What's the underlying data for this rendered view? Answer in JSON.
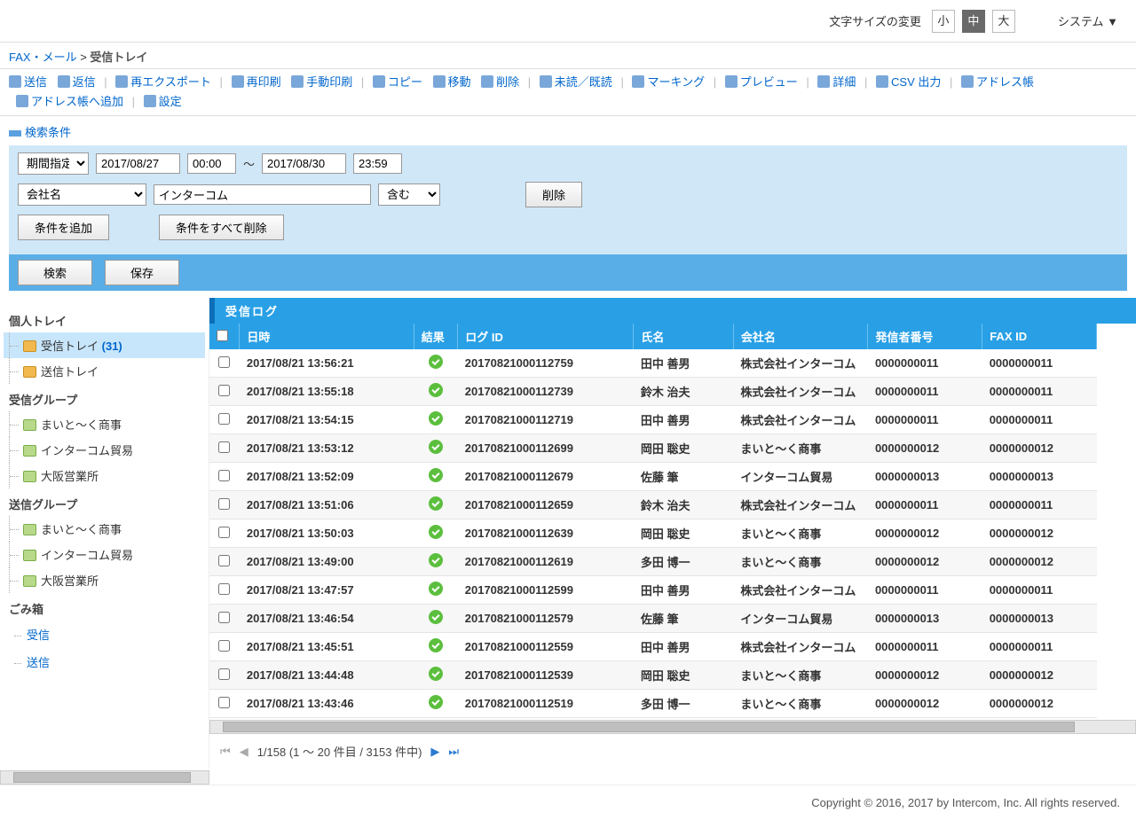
{
  "topbar": {
    "font_size_label": "文字サイズの変更",
    "small": "小",
    "medium": "中",
    "large": "大",
    "system": "システム ▼"
  },
  "breadcrumb": {
    "root": "FAX・メール",
    "sep": " > ",
    "current": "受信トレイ"
  },
  "toolbar": {
    "send": "送信",
    "reply": "返信",
    "reexport": "再エクスポート",
    "reprint": "再印刷",
    "manual_print": "手動印刷",
    "copy": "コピー",
    "move": "移動",
    "delete": "削除",
    "read_unread": "未読／既読",
    "marking": "マーキング",
    "preview": "プレビュー",
    "detail": "詳細",
    "csv": "CSV 出力",
    "addrbook": "アドレス帳",
    "addrbook_add": "アドレス帳へ追加",
    "settings": "設定"
  },
  "search": {
    "title": "検索条件",
    "period_select": "期間指定",
    "date_from": "2017/08/27",
    "time_from": "00:00",
    "tilde": "〜",
    "date_to": "2017/08/30",
    "time_to": "23:59",
    "field_select": "会社名",
    "value": "インターコム",
    "match_select": "含む",
    "row_delete": "削除",
    "add_condition": "条件を追加",
    "clear_all": "条件をすべて削除",
    "search_btn": "検索",
    "save_btn": "保存"
  },
  "sidebar": {
    "personal": "個人トレイ",
    "inbox": "受信トレイ",
    "inbox_count": "(31)",
    "outbox": "送信トレイ",
    "recv_group": "受信グループ",
    "send_group": "送信グループ",
    "groups": [
      "まいと〜く商事",
      "インターコム貿易",
      "大阪営業所"
    ],
    "trash": "ごみ箱",
    "trash_recv": "受信",
    "trash_send": "送信"
  },
  "content": {
    "title": "受信ログ",
    "headers": {
      "datetime": "日時",
      "result": "結果",
      "logid": "ログ ID",
      "name": "氏名",
      "company": "会社名",
      "caller": "発信者番号",
      "faxid": "FAX ID"
    },
    "rows": [
      {
        "dt": "2017/08/21 13:56:21",
        "id": "20170821000112759",
        "name": "田中 善男",
        "co": "株式会社インターコム",
        "num": "0000000011",
        "fax": "0000000011"
      },
      {
        "dt": "2017/08/21 13:55:18",
        "id": "20170821000112739",
        "name": "鈴木 治夫",
        "co": "株式会社インターコム",
        "num": "0000000011",
        "fax": "0000000011"
      },
      {
        "dt": "2017/08/21 13:54:15",
        "id": "20170821000112719",
        "name": "田中 善男",
        "co": "株式会社インターコム",
        "num": "0000000011",
        "fax": "0000000011"
      },
      {
        "dt": "2017/08/21 13:53:12",
        "id": "20170821000112699",
        "name": "岡田 聡史",
        "co": "まいと〜く商事",
        "num": "0000000012",
        "fax": "0000000012"
      },
      {
        "dt": "2017/08/21 13:52:09",
        "id": "20170821000112679",
        "name": "佐藤 筆",
        "co": "インターコム貿易",
        "num": "0000000013",
        "fax": "0000000013"
      },
      {
        "dt": "2017/08/21 13:51:06",
        "id": "20170821000112659",
        "name": "鈴木 治夫",
        "co": "株式会社インターコム",
        "num": "0000000011",
        "fax": "0000000011"
      },
      {
        "dt": "2017/08/21 13:50:03",
        "id": "20170821000112639",
        "name": "岡田 聡史",
        "co": "まいと〜く商事",
        "num": "0000000012",
        "fax": "0000000012"
      },
      {
        "dt": "2017/08/21 13:49:00",
        "id": "20170821000112619",
        "name": "多田 博一",
        "co": "まいと〜く商事",
        "num": "0000000012",
        "fax": "0000000012"
      },
      {
        "dt": "2017/08/21 13:47:57",
        "id": "20170821000112599",
        "name": "田中 善男",
        "co": "株式会社インターコム",
        "num": "0000000011",
        "fax": "0000000011"
      },
      {
        "dt": "2017/08/21 13:46:54",
        "id": "20170821000112579",
        "name": "佐藤 筆",
        "co": "インターコム貿易",
        "num": "0000000013",
        "fax": "0000000013"
      },
      {
        "dt": "2017/08/21 13:45:51",
        "id": "20170821000112559",
        "name": "田中 善男",
        "co": "株式会社インターコム",
        "num": "0000000011",
        "fax": "0000000011"
      },
      {
        "dt": "2017/08/21 13:44:48",
        "id": "20170821000112539",
        "name": "岡田 聡史",
        "co": "まいと〜く商事",
        "num": "0000000012",
        "fax": "0000000012"
      },
      {
        "dt": "2017/08/21 13:43:46",
        "id": "20170821000112519",
        "name": "多田 博一",
        "co": "まいと〜く商事",
        "num": "0000000012",
        "fax": "0000000012"
      }
    ],
    "pager_text": "1/158 (1 〜 20 件目 / 3153 件中)"
  },
  "footer": "Copyright © 2016, 2017 by Intercom, Inc. All rights reserved."
}
